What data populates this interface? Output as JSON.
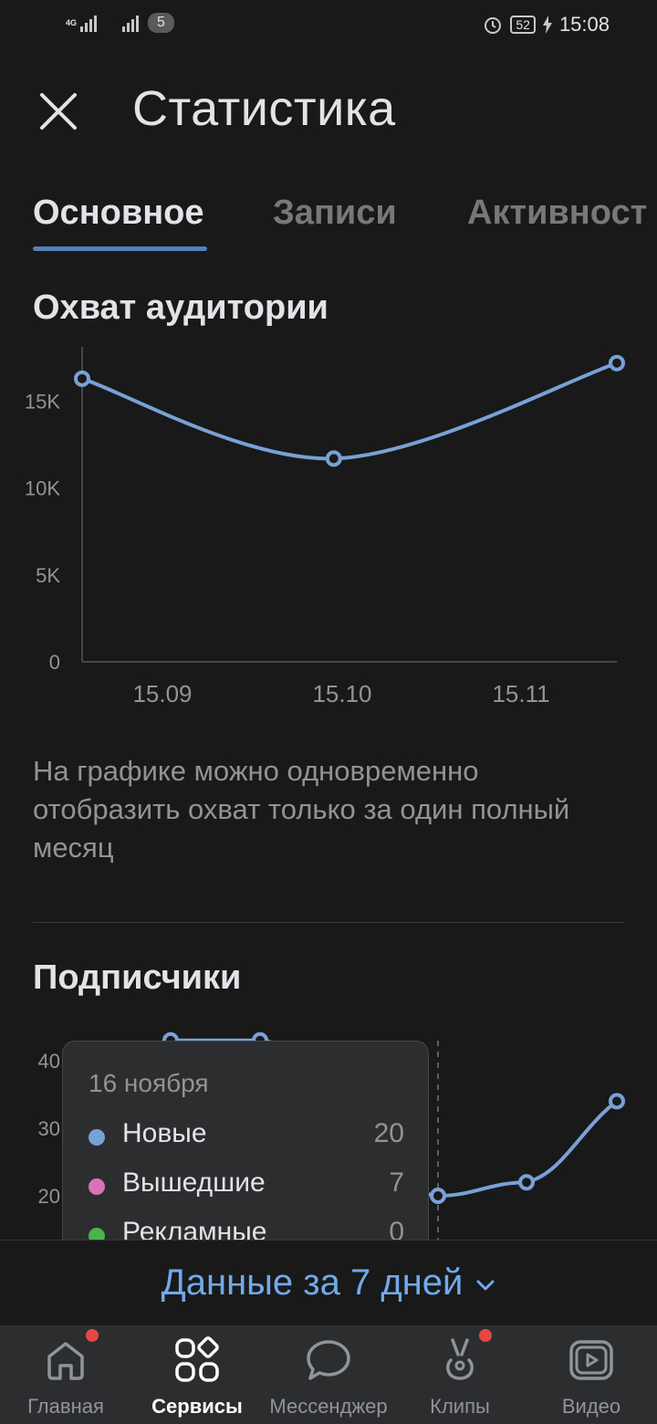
{
  "status_bar": {
    "net_type": "4G",
    "sim_badge": "5",
    "battery": "52",
    "time": "15:08"
  },
  "header": {
    "title": "Статистика"
  },
  "tabs": [
    {
      "label": "Основное",
      "active": true
    },
    {
      "label": "Записи",
      "active": false
    },
    {
      "label": "Активност",
      "active": false
    }
  ],
  "reach": {
    "title": "Охват аудитории",
    "note": "На графике можно одновременно отобразить охват только за один полный месяц"
  },
  "subscribers": {
    "title": "Подписчики"
  },
  "chart_data": [
    {
      "type": "line",
      "title": "Охват аудитории",
      "x_tick_labels": [
        "15.09",
        "15.10",
        "15.11"
      ],
      "y_tick_labels": [
        "0",
        "5K",
        "10K",
        "15K"
      ],
      "ylim": [
        0,
        17500
      ],
      "series": [
        {
          "x": [
            "2023-09-08",
            "2023-10-10",
            "2023-11-15"
          ],
          "values": [
            16300,
            11700,
            17200
          ]
        }
      ],
      "color": "#78a2d6",
      "grid": false
    },
    {
      "type": "line",
      "title": "Подписчики",
      "y_tick_labels": [
        "20",
        "30",
        "40"
      ],
      "ylim": [
        0,
        45
      ],
      "series": [
        {
          "name": "Новые",
          "values": [
            43,
            43,
            20,
            22,
            34
          ]
        }
      ],
      "color": "#78a2d6",
      "grid": false
    }
  ],
  "tooltip": {
    "date": "16 ноября",
    "rows": [
      {
        "label": "Новые",
        "value": "20",
        "color": "#78a2d6"
      },
      {
        "label": "Вышедшие",
        "value": "7",
        "color": "#d972b6"
      },
      {
        "label": "Рекламные",
        "value": "0",
        "color": "#4bb34b"
      }
    ]
  },
  "data_range": {
    "label": "Данные за 7 дней"
  },
  "nav": [
    {
      "label": "Главная",
      "icon": "home-icon",
      "active": false,
      "badge": true
    },
    {
      "label": "Сервисы",
      "icon": "services-icon",
      "active": true,
      "badge": false
    },
    {
      "label": "Мессенджер",
      "icon": "messenger-icon",
      "active": false,
      "badge": false
    },
    {
      "label": "Клипы",
      "icon": "clips-icon",
      "active": false,
      "badge": true
    },
    {
      "label": "Видео",
      "icon": "video-icon",
      "active": false,
      "badge": false
    }
  ],
  "colors": {
    "accent": "#5181b8",
    "link": "#71aaeb",
    "line": "#78a2d6",
    "badge": "#e64646"
  }
}
